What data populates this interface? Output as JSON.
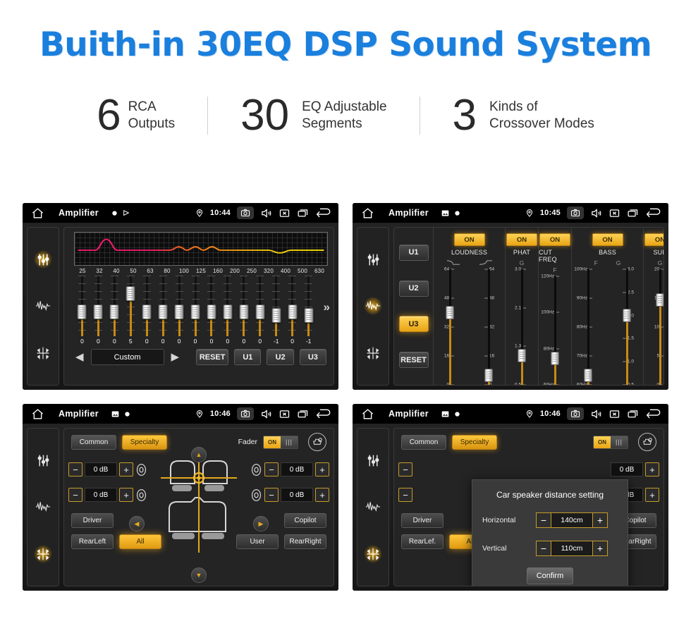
{
  "headline": "Buith-in 30EQ DSP Sound System",
  "stats": [
    {
      "number": "6",
      "line1": "RCA",
      "line2": "Outputs"
    },
    {
      "number": "30",
      "line1": "EQ Adjustable",
      "line2": "Segments"
    },
    {
      "number": "3",
      "line1": "Kinds of",
      "line2": "Crossover Modes"
    }
  ],
  "colors": {
    "headline": "#1a7fdd",
    "amber": "#e9a514",
    "panel_bg": "#242424",
    "status_bg": "#000000"
  },
  "panels": {
    "eq": {
      "statusbar": {
        "home_icon": "home-icon",
        "title": "Amplifier",
        "mini_icons": [
          "dot-icon",
          "play-triangle-icon"
        ],
        "location_icon": "location-pin-icon",
        "time": "10:44",
        "icons": [
          "camera-icon",
          "volume-icon",
          "close-box-icon",
          "recents-icon",
          "back-arrow-icon"
        ]
      },
      "sidebar": [
        {
          "icon": "sliders-icon",
          "active": true
        },
        {
          "icon": "waveform-icon",
          "active": false
        },
        {
          "icon": "balance-icon",
          "active": false
        }
      ],
      "frequencies": [
        "25",
        "32",
        "40",
        "50",
        "63",
        "80",
        "100",
        "125",
        "160",
        "200",
        "250",
        "320",
        "400",
        "500",
        "630"
      ],
      "values": [
        0,
        0,
        0,
        5,
        0,
        0,
        0,
        0,
        0,
        0,
        0,
        0,
        -1,
        0,
        -1
      ],
      "prev_label": "◀",
      "next_label": "▶",
      "preset_name": "Custom",
      "reset_label": "RESET",
      "user_presets": [
        "U1",
        "U2",
        "U3"
      ],
      "expand_icon": "chevron-double-right-icon"
    },
    "dsp": {
      "statusbar": {
        "home_icon": "home-icon",
        "title": "Amplifier",
        "mini_icons": [
          "image-icon",
          "dot-icon"
        ],
        "location_icon": "location-pin-icon",
        "time": "10:45",
        "icons": [
          "camera-icon",
          "volume-icon",
          "close-box-icon",
          "recents-icon",
          "back-arrow-icon"
        ]
      },
      "sidebar": [
        {
          "icon": "sliders-icon",
          "active": false
        },
        {
          "icon": "waveform-icon",
          "active": true
        },
        {
          "icon": "balance-icon",
          "active": false
        }
      ],
      "presets": [
        {
          "label": "U1",
          "active": false
        },
        {
          "label": "U2",
          "active": false
        },
        {
          "label": "U3",
          "active": true
        },
        {
          "label": "RESET",
          "active": false
        }
      ],
      "columns": [
        {
          "label": "LOUDNESS",
          "state": "ON",
          "sub": [
            "curve-down-icon",
            "curve-up-icon"
          ],
          "faders": [
            {
              "ticks": [
                "64",
                "48",
                "32",
                "16",
                "0"
              ],
              "value_pct": 62,
              "side": "left"
            },
            {
              "ticks": [
                "64",
                "48",
                "32",
                "16",
                "0"
              ],
              "value_pct": 8,
              "side": "right"
            }
          ]
        },
        {
          "label": "PHAT",
          "state": "ON",
          "sub": [
            "G"
          ],
          "faders": [
            {
              "ticks": [
                "3.0",
                "2.1",
                "1.3",
                "0.5"
              ],
              "value_pct": 25,
              "side": "left"
            }
          ]
        },
        {
          "label": "CUT FREQ",
          "state": "ON",
          "sub": [
            "F"
          ],
          "faders": [
            {
              "ticks": [
                "120Hz",
                "100Hz",
                "80Hz",
                "60Hz"
              ],
              "value_pct": 24,
              "side": "left"
            }
          ]
        },
        {
          "label": "BASS",
          "state": "ON",
          "sub": [
            "F",
            "G"
          ],
          "faders": [
            {
              "ticks": [
                "100Hz",
                "90Hz",
                "80Hz",
                "70Hz",
                "60Hz"
              ],
              "value_pct": 8,
              "side": "left"
            },
            {
              "ticks": [
                "3.0",
                "2.5",
                "2.0",
                "1.5",
                "1.0",
                "0.5"
              ],
              "value_pct": 60,
              "side": "right"
            }
          ]
        },
        {
          "label": "SUB",
          "state": "ON",
          "sub": [
            "G"
          ],
          "faders": [
            {
              "ticks": [
                "20",
                "15",
                "10",
                "5",
                "0"
              ],
              "value_pct": 73,
              "side": "left"
            }
          ]
        }
      ]
    },
    "balance": {
      "statusbar": {
        "home_icon": "home-icon",
        "title": "Amplifier",
        "mini_icons": [
          "image-icon",
          "dot-icon"
        ],
        "location_icon": "location-pin-icon",
        "time": "10:46",
        "icons": [
          "camera-icon",
          "volume-icon",
          "close-box-icon",
          "recents-icon",
          "back-arrow-icon"
        ]
      },
      "sidebar": [
        {
          "icon": "sliders-icon",
          "active": false
        },
        {
          "icon": "waveform-icon",
          "active": false
        },
        {
          "icon": "balance-icon",
          "active": true
        }
      ],
      "tabs": [
        {
          "label": "Common",
          "active": false
        },
        {
          "label": "Specialty",
          "active": true
        }
      ],
      "fader_label": "Fader",
      "fader_state": "ON",
      "seat_settings_icon": "car-seat-settings-icon",
      "db_controls": [
        {
          "position": "front-left",
          "minus": "−",
          "value": "0 dB",
          "plus": "+"
        },
        {
          "position": "front-right",
          "minus": "−",
          "value": "0 dB",
          "plus": "+"
        },
        {
          "position": "rear-left",
          "minus": "−",
          "value": "0 dB",
          "plus": "+"
        },
        {
          "position": "rear-right",
          "minus": "−",
          "value": "0 dB",
          "plus": "+"
        }
      ],
      "buttons": [
        {
          "label": "Driver",
          "active": false
        },
        {
          "label": "Copilot",
          "active": false
        },
        {
          "label": "RearLeft",
          "active": false
        },
        {
          "label": "All",
          "active": true
        },
        {
          "label": "User",
          "active": false
        },
        {
          "label": "RearRight",
          "active": false
        }
      ],
      "nav_arrows": [
        "up-arrow-icon",
        "down-arrow-icon",
        "left-arrow-icon",
        "right-arrow-icon"
      ]
    },
    "dialog_panel": {
      "statusbar": {
        "home_icon": "home-icon",
        "title": "Amplifier",
        "mini_icons": [
          "image-icon",
          "dot-icon"
        ],
        "location_icon": "location-pin-icon",
        "time": "10:46",
        "icons": [
          "camera-icon",
          "volume-icon",
          "close-box-icon",
          "recents-icon",
          "back-arrow-icon"
        ]
      },
      "sidebar": [
        {
          "icon": "sliders-icon",
          "active": false
        },
        {
          "icon": "waveform-icon",
          "active": false
        },
        {
          "icon": "balance-icon",
          "active": true
        }
      ],
      "tabs": [
        {
          "label": "Common",
          "active": false
        },
        {
          "label": "Specialty",
          "active": true
        }
      ],
      "fader_state": "ON",
      "buttons": [
        {
          "label": "Driver",
          "active": false
        },
        {
          "label": "Copilot",
          "active": false
        },
        {
          "label": "RearLef.",
          "active": false
        },
        {
          "label": "All",
          "active": true
        },
        {
          "label": "User",
          "active": false
        },
        {
          "label": "RearRight",
          "active": false
        }
      ],
      "db_values": [
        "0 dB",
        "0 dB"
      ],
      "dialog": {
        "title": "Car speaker distance setting",
        "rows": [
          {
            "label": "Horizontal",
            "minus": "−",
            "value": "140cm",
            "plus": "+"
          },
          {
            "label": "Vertical",
            "minus": "−",
            "value": "110cm",
            "plus": "+"
          }
        ],
        "confirm_label": "Confirm"
      }
    }
  }
}
